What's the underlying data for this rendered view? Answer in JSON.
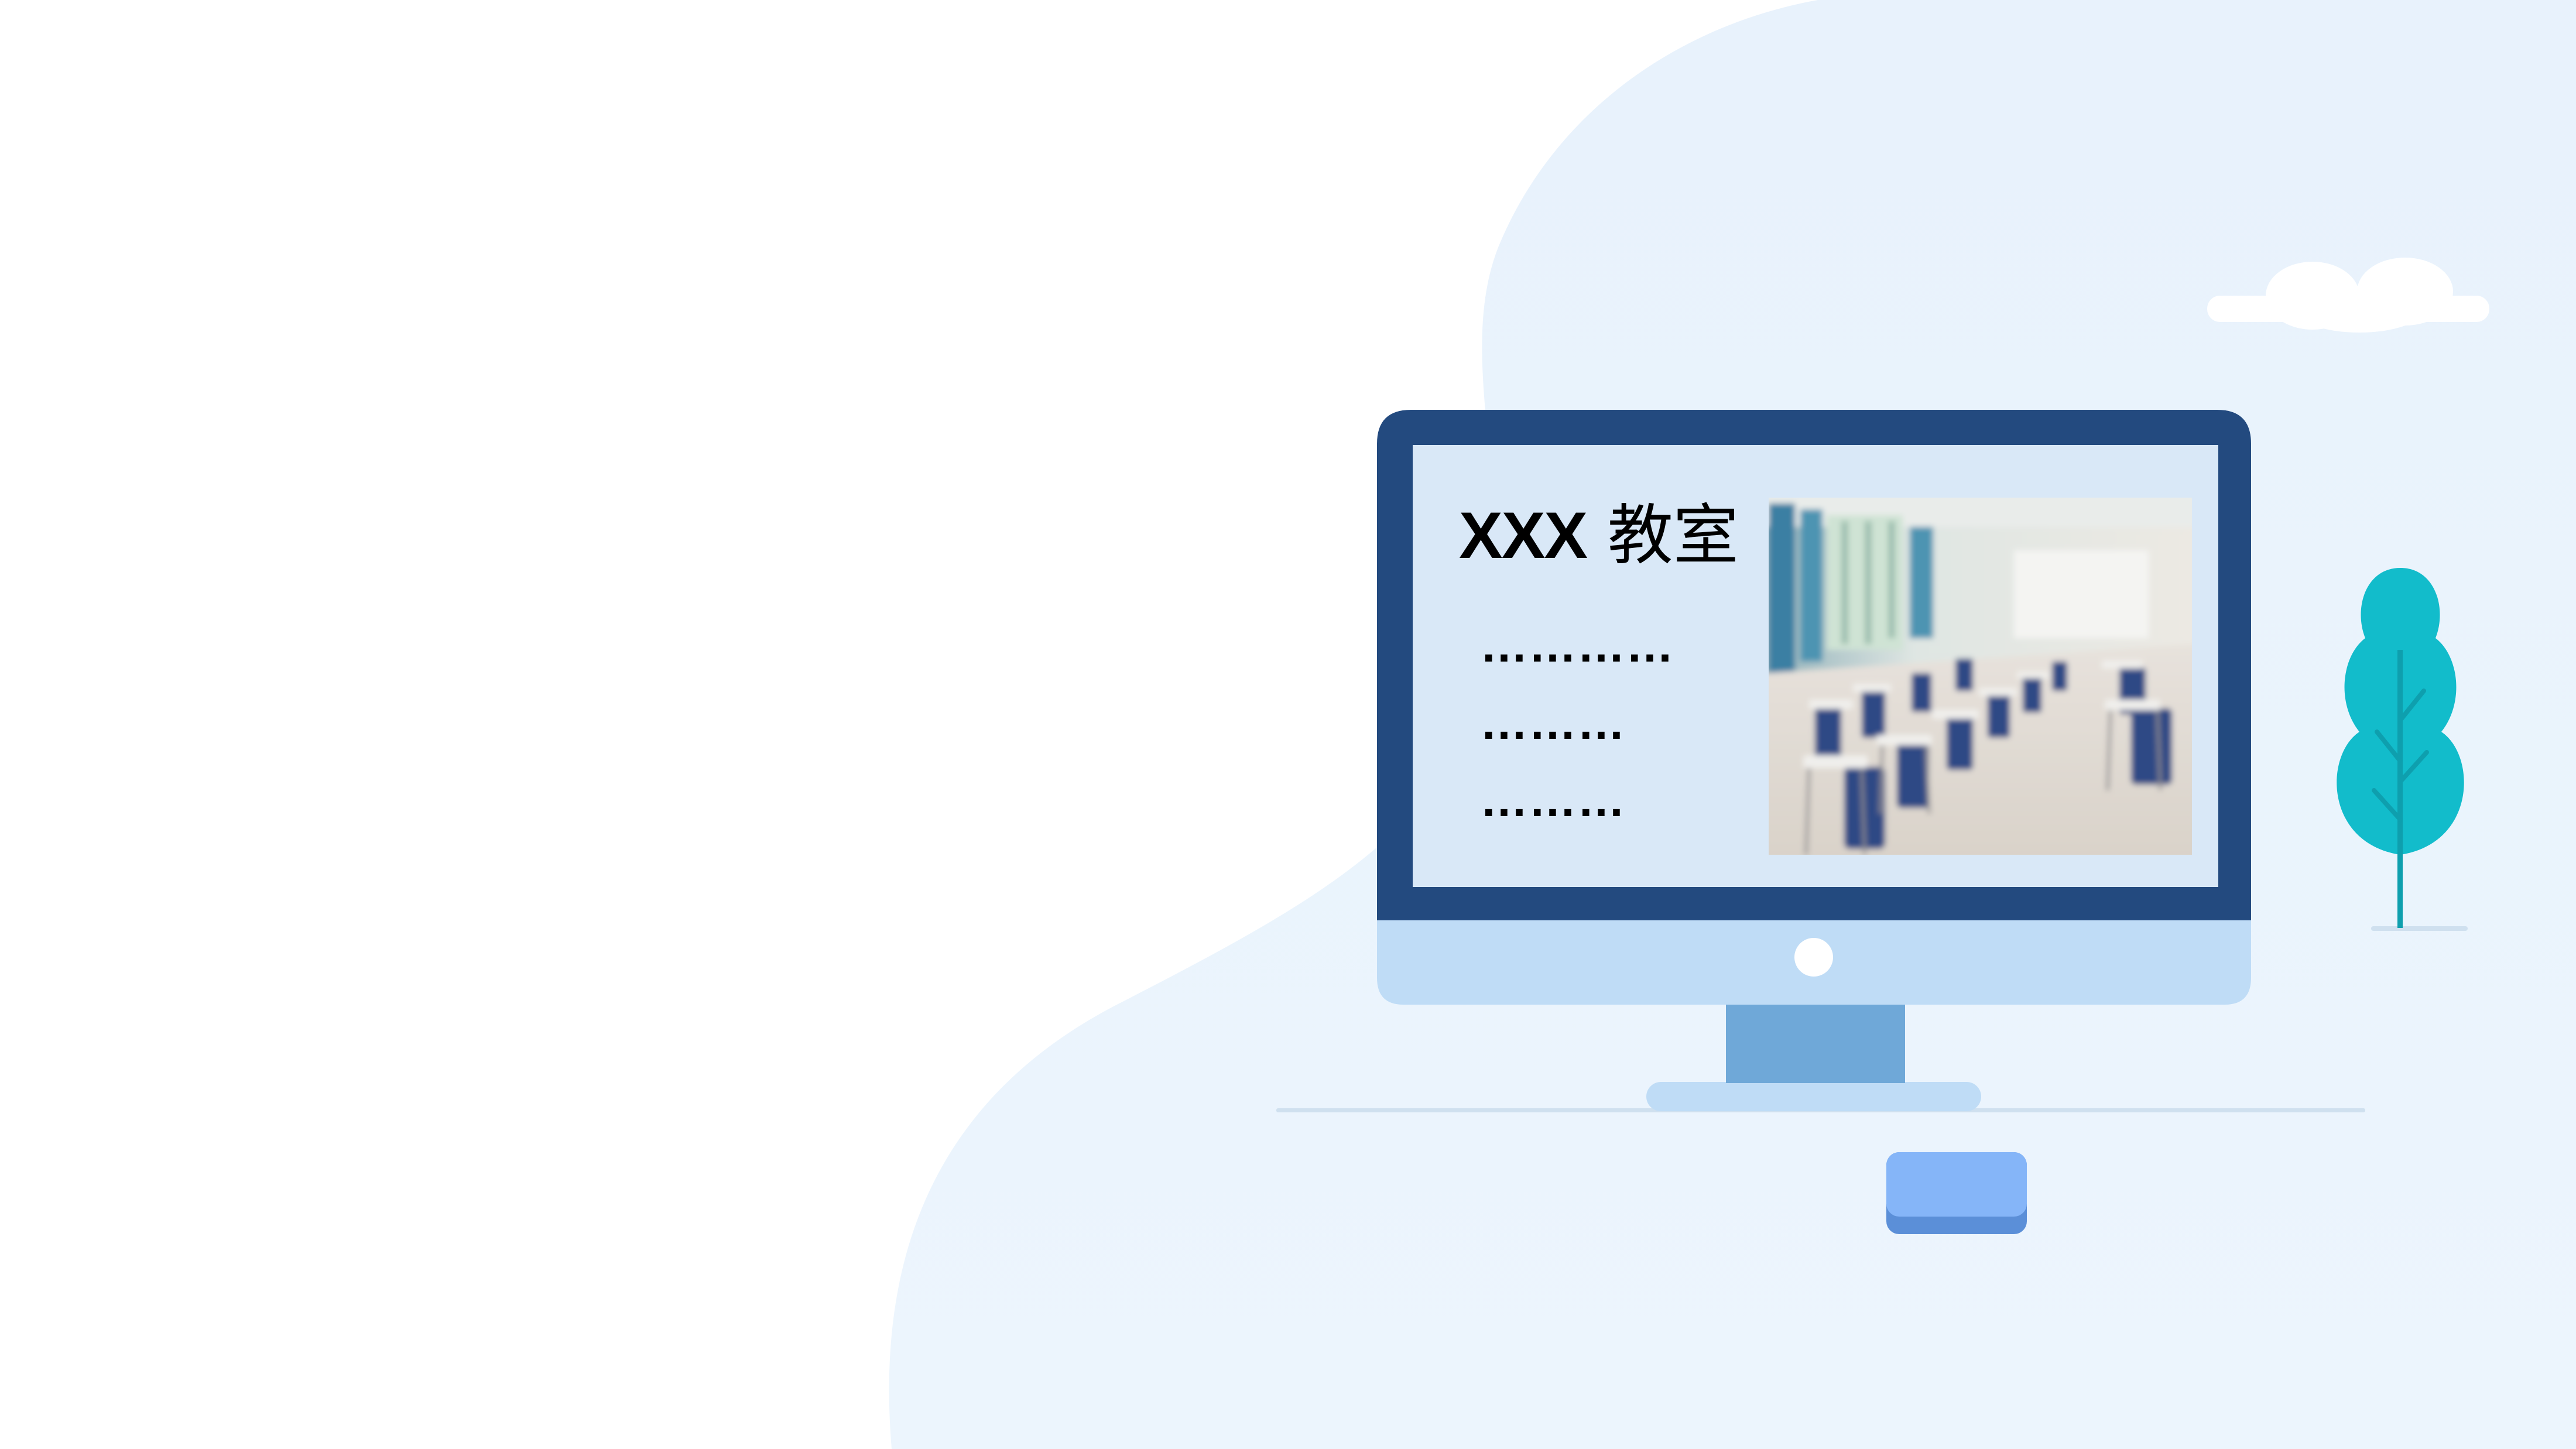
{
  "slide": {
    "screen": {
      "title_latin": "XXX",
      "title_cjk": "教室",
      "lines": [
        "…………",
        "………",
        "………"
      ],
      "photo": "blurred-classroom-photo"
    }
  },
  "icons": [
    "monitor-icon",
    "tree-icon",
    "cloud-icon",
    "mouse-icon"
  ],
  "colors": {
    "background": "#ffffff",
    "blob": "#e8f2fc",
    "monitor_frame": "#234a7f",
    "monitor_screen": "#d9e8f7",
    "monitor_chin": "#bfdcf6",
    "monitor_stand": "#6fa8d8",
    "tree": "#12bccb",
    "mouse": "#7fb1f7"
  }
}
